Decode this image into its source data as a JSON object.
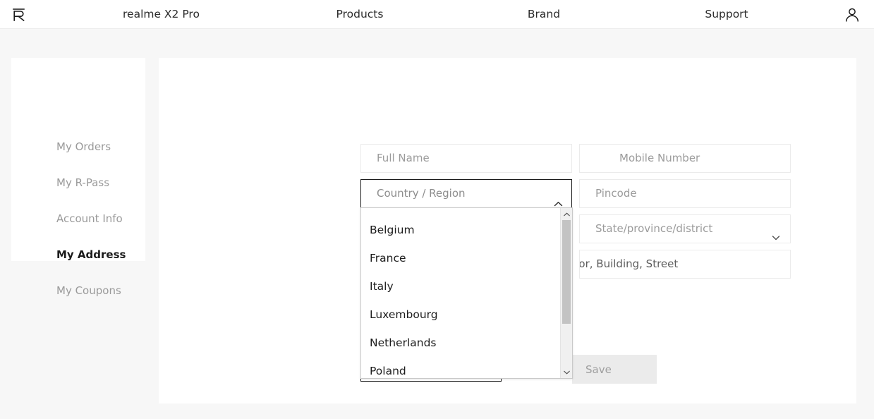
{
  "topnav": {
    "logo_icon": "realme-logo-icon",
    "account_icon": "user-account-icon",
    "links": [
      {
        "label": "realme X2 Pro"
      },
      {
        "label": "Products"
      },
      {
        "label": "Brand"
      },
      {
        "label": "Support"
      }
    ]
  },
  "sidebar": {
    "items": [
      {
        "label": "My Orders",
        "active": false
      },
      {
        "label": "My R-Pass",
        "active": false
      },
      {
        "label": "Account Info",
        "active": false
      },
      {
        "label": "My Address",
        "active": true
      },
      {
        "label": "My Coupons",
        "active": false
      }
    ]
  },
  "form": {
    "full_name": {
      "placeholder": "Full Name",
      "value": ""
    },
    "mobile_number": {
      "placeholder": "Mobile Number",
      "value": ""
    },
    "country_region": {
      "placeholder": "Country / Region",
      "value": "",
      "expanded": true,
      "chevron": "chevron-up-icon"
    },
    "pincode": {
      "placeholder": "Pincode",
      "value": ""
    },
    "state": {
      "placeholder": "State/province/district",
      "value": "",
      "chevron": "chevron-down-icon"
    },
    "address": {
      "placeholder": "No., Floor, Building, Street",
      "value": ""
    },
    "save_button": {
      "label": "Save",
      "disabled": true
    }
  },
  "country_dropdown": {
    "visible_options": [
      "Belgium",
      "France",
      "Italy",
      "Luxembourg",
      "Netherlands",
      "Poland"
    ],
    "scrollbar": {
      "up_arrow_icon": "scroll-up-arrow-icon",
      "down_arrow_icon": "scroll-down-arrow-icon"
    }
  },
  "colors": {
    "page_background": "#f7f7f7",
    "panel_background": "#ffffff",
    "text_primary": "#1d1d1d",
    "text_muted": "#9a9a9a",
    "field_border": "#ebebeb",
    "focus_border": "#1a1a1a",
    "disabled_button": "#ebebeb"
  }
}
